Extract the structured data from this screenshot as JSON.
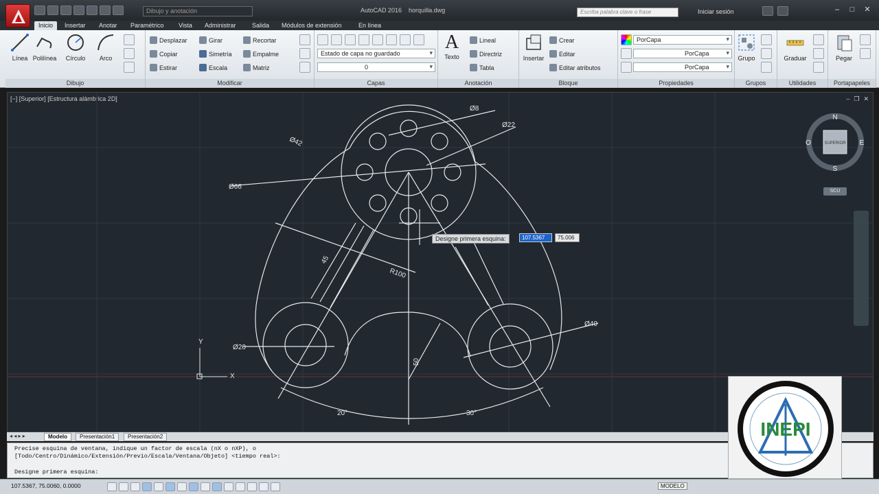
{
  "titlebar": {
    "workspace": "Dibujo y anotación",
    "app_name": "AutoCAD 2016",
    "file_name": "horquilla.dwg",
    "search_placeholder": "Escriba palabra clave o frase",
    "signin": "Iniciar sesión"
  },
  "tabs": [
    "Inicio",
    "Insertar",
    "Anotar",
    "Paramétrico",
    "Vista",
    "Administrar",
    "Salida",
    "Módulos de extensión",
    "En línea"
  ],
  "ribbon": {
    "dibujo": {
      "title": "Dibujo",
      "tools": [
        "Línea",
        "Polilínea",
        "Círculo",
        "Arco"
      ]
    },
    "modificar": {
      "title": "Modificar",
      "tools": [
        "Desplazar",
        "Girar",
        "Recortar",
        "Copiar",
        "Simetría",
        "Empalme",
        "Estirar",
        "Escala",
        "Matriz"
      ]
    },
    "capas": {
      "title": "Capas",
      "state": "Estado de capa no guardado",
      "layer": "0"
    },
    "anotacion": {
      "title": "Anotación",
      "texto": "Texto",
      "lineal": "Lineal",
      "directriz": "Directriz",
      "tabla": "Tabla"
    },
    "bloque": {
      "title": "Bloque",
      "insertar": "Insertar",
      "crear": "Crear",
      "editar": "Editar",
      "editar_atributos": "Editar atributos"
    },
    "propiedades": {
      "title": "Propiedades",
      "color": "PorCapa",
      "linetype": "PorCapa",
      "lineweight": "PorCapa"
    },
    "grupos": {
      "title": "Grupos",
      "grupo": "Grupo"
    },
    "utilidades": {
      "title": "Utilidades",
      "graduar": "Graduar"
    },
    "portapapeles": {
      "title": "Portapapeles",
      "pegar": "Pegar"
    }
  },
  "viewport": {
    "label": "[−] [Superior] [Estructura alámbrica 2D]",
    "viewcube": {
      "n": "N",
      "s": "S",
      "e": "E",
      "o": "O",
      "face": "SUPERIOR"
    },
    "wcs": "SCU"
  },
  "drawing_labels": {
    "d8": "Ø8",
    "d22": "Ø22",
    "d42": "Ø42",
    "d66": "Ø66",
    "d20": "Ø20",
    "d40": "Ø40",
    "r100": "R100",
    "d45": "45",
    "d50": "50",
    "a20": "20°",
    "a30": "30°",
    "axis_y": "Y",
    "axis_x": "X"
  },
  "dynamic_input": {
    "prompt": "Designe primera esquina:",
    "x": "107.5367",
    "y": "75.006"
  },
  "layout_tabs": [
    "Modelo",
    "Presentación1",
    "Presentación2"
  ],
  "command": {
    "line1": "Precise esquina de ventana, indique un factor de escala (nX o nXP), o",
    "line2": "[Todo/Centro/Dinámico/Extensión/Previo/Escala/Ventana/Objeto] <tiempo real>:",
    "line3": "Designe primera esquina:"
  },
  "statusbar": {
    "coords": "107.5367, 75.0060, 0.0000",
    "model": "MODELO"
  },
  "watermark": {
    "text": "INEPI"
  }
}
